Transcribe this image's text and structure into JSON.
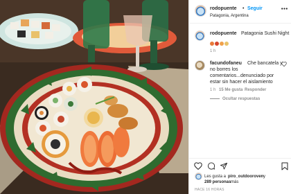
{
  "post": {
    "username": "rodopuente",
    "dot": "•",
    "follow_label": "Seguir",
    "location": "Patagonia, Argentina",
    "caption_user": "rodopuente",
    "caption_text": "Patagonia Sushi Night",
    "caption_emojis": [
      "sushi-emoji",
      "sushi-emoji",
      "sushi-emoji",
      "sushi-emoji"
    ],
    "caption_time": "1 h"
  },
  "comment": {
    "user": "facundofaneu",
    "text_line1": "Che bancatela y",
    "text_line2": "no borres los",
    "text_line3": "comentarios...denunciado por",
    "text_line4": "estar sin hacer el aislamiento",
    "time": "1 h",
    "likes": "15 Me gusta",
    "reply": "Responder",
    "hide_replies": "Ocultar respuestas"
  },
  "likes": {
    "line1_prefix": "Les gusta a",
    "line1_user": "piro_outdooroven",
    "line1_suffix": "y",
    "line2_count": "289 personas",
    "line2_suffix": "más"
  },
  "timestamp": "HACE 16 HORAS",
  "icons": {
    "more": "more-horizontal-icon",
    "heart": "heart-icon",
    "comment": "comment-icon",
    "share": "share-icon",
    "save": "bookmark-icon",
    "comment_like": "heart-small-icon"
  },
  "colors": {
    "accent": "#0095f6",
    "plate_green": "#2f6b2f",
    "plate_red": "#a3281f",
    "table": "#3a2b20"
  }
}
